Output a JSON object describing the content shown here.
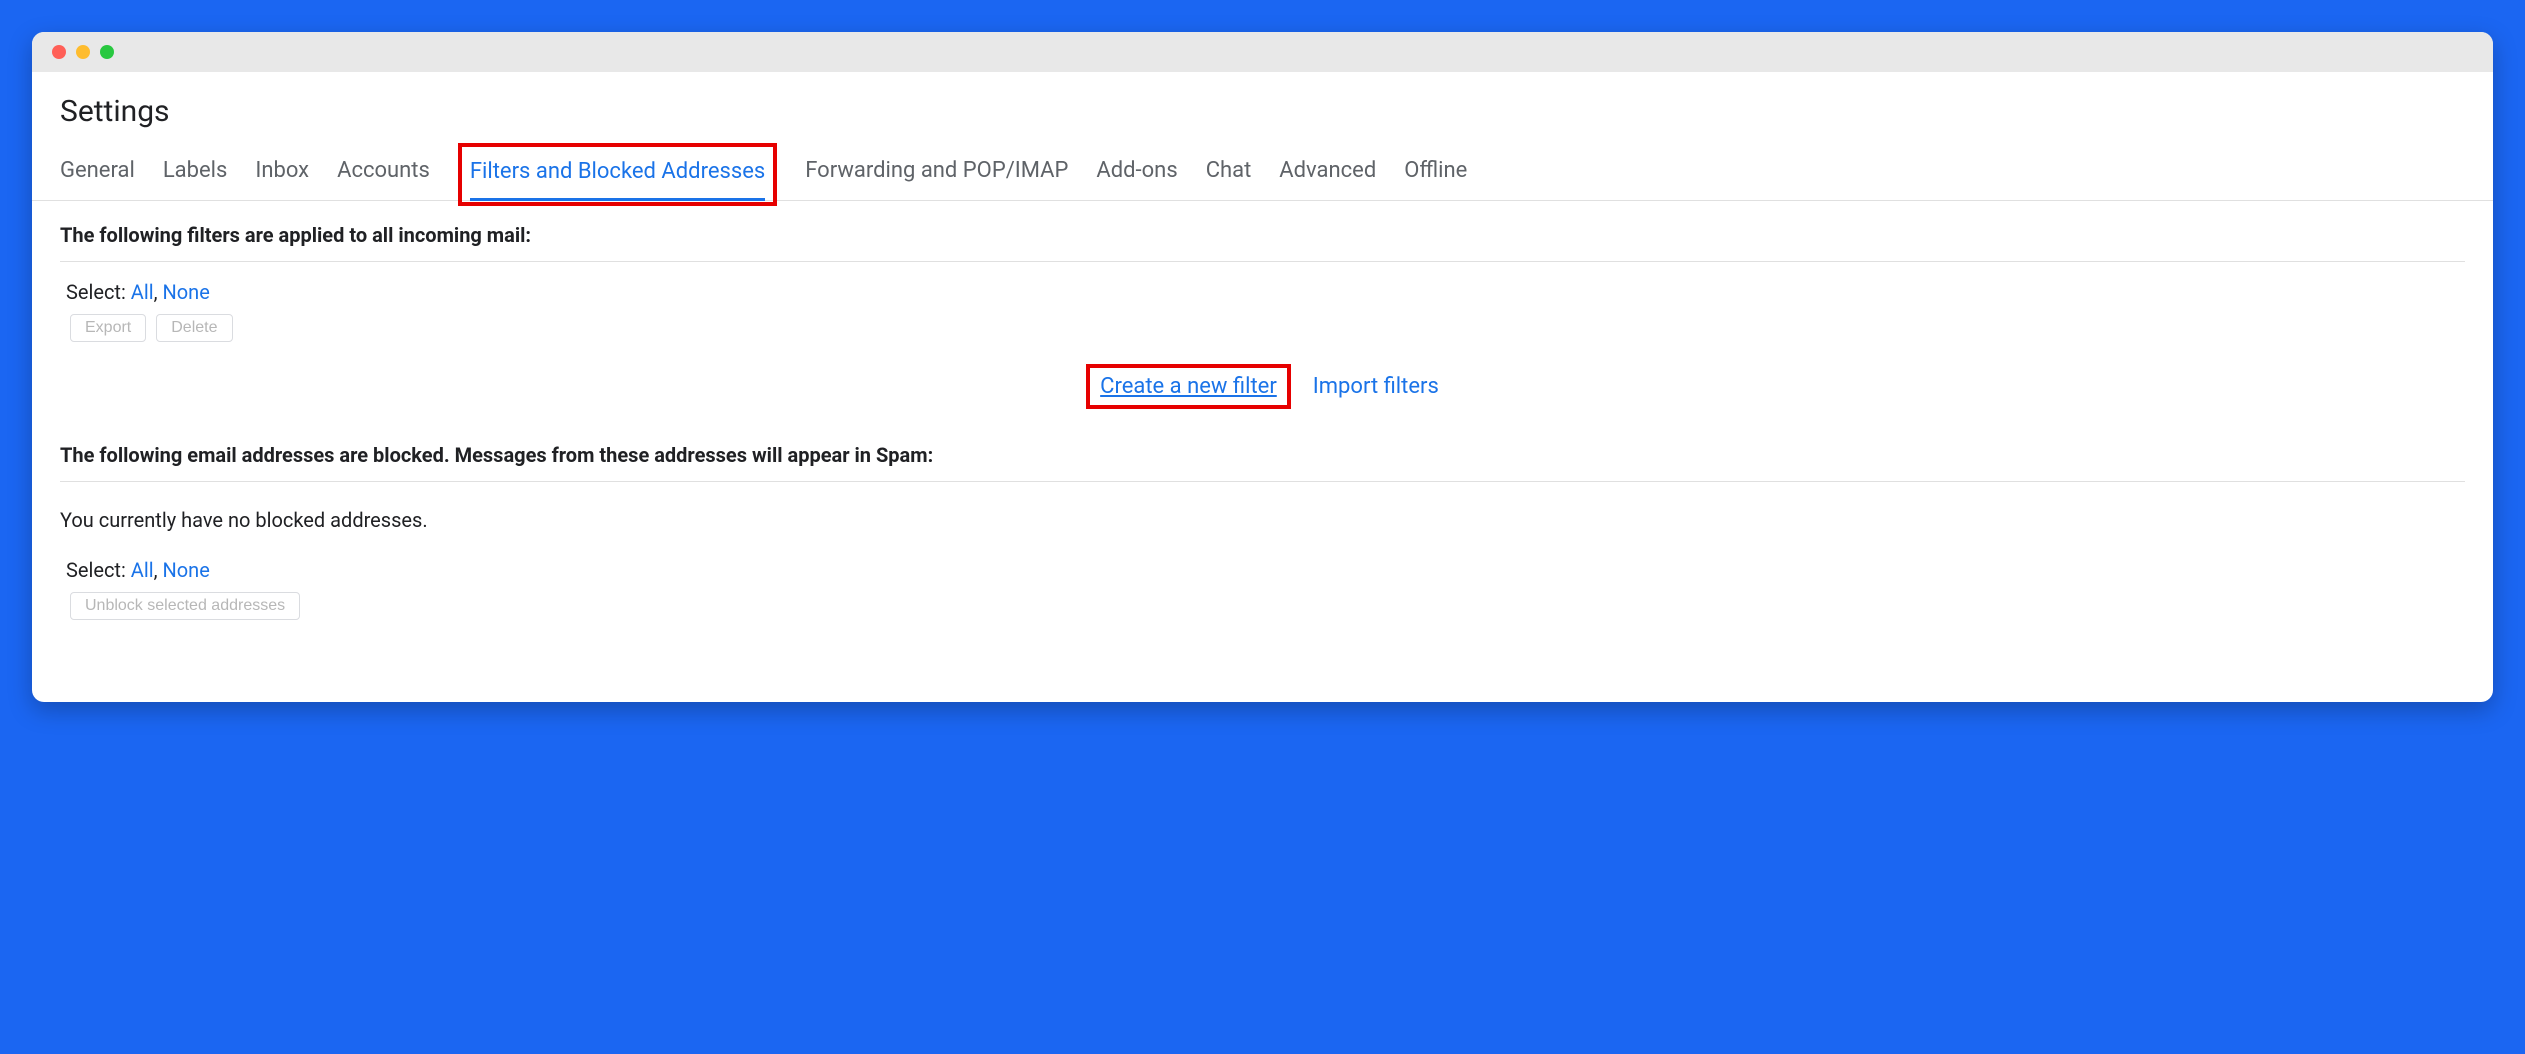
{
  "header": {
    "title": "Settings"
  },
  "tabs": {
    "general": "General",
    "labels": "Labels",
    "inbox": "Inbox",
    "accounts": "Accounts",
    "filters": "Filters and Blocked Addresses",
    "forwarding": "Forwarding and POP/IMAP",
    "addons": "Add-ons",
    "chat": "Chat",
    "advanced": "Advanced",
    "offline": "Offline"
  },
  "filters": {
    "heading": "The following filters are applied to all incoming mail:",
    "select_label": "Select:",
    "select_all": "All",
    "select_none": "None",
    "export": "Export",
    "delete": "Delete",
    "create_new": "Create a new filter",
    "import": "Import filters"
  },
  "blocked": {
    "heading": "The following email addresses are blocked. Messages from these addresses will appear in Spam:",
    "empty": "You currently have no blocked addresses.",
    "select_label": "Select:",
    "select_all": "All",
    "select_none": "None",
    "unblock": "Unblock selected addresses"
  },
  "highlights": {
    "tab_filters": true,
    "create_new_filter": true
  }
}
